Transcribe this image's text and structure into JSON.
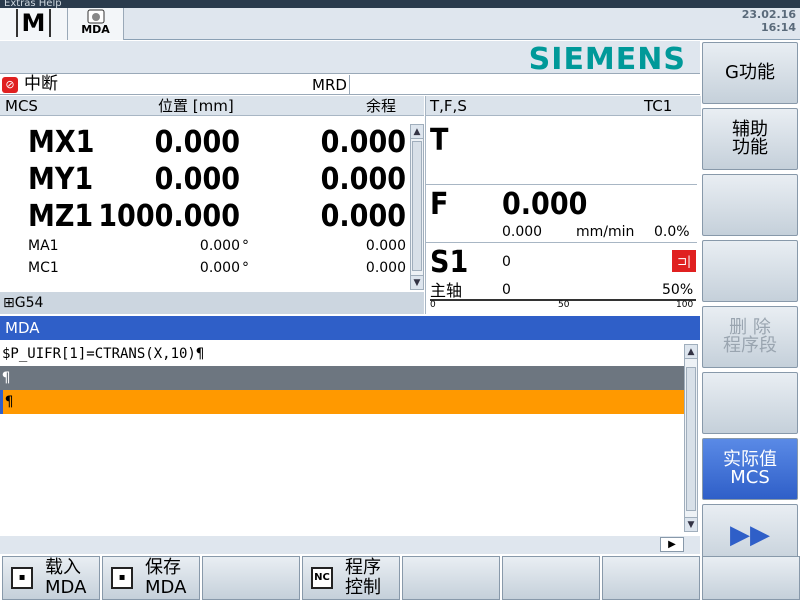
{
  "menubar": {
    "text": "Extras   Help"
  },
  "header": {
    "mode_icon_letter": "M",
    "mda_label": "MDA",
    "date": "23.02.16",
    "time": "16:14"
  },
  "brand": "SIEMENS",
  "status": {
    "alarm": "中断",
    "mrd": "MRD"
  },
  "position_pane": {
    "col_mcs": "MCS",
    "col_position": "位置 [mm]",
    "col_remaining": "余程",
    "axes_main": [
      {
        "name": "MX1",
        "pos": "0.000",
        "rest": "0.000"
      },
      {
        "name": "MY1",
        "pos": "0.000",
        "rest": "0.000"
      },
      {
        "name": "MZ1",
        "pos": "1000.000",
        "rest": "0.000"
      }
    ],
    "axes_small": [
      {
        "name": "MA1",
        "pos": "0.000",
        "unit": "°",
        "rest": "0.000"
      },
      {
        "name": "MC1",
        "pos": "0.000",
        "unit": "°",
        "rest": "0.000"
      }
    ],
    "frame": "G54"
  },
  "tfs": {
    "title": "T,F,S",
    "tool_carrier": "TC1",
    "t_label": "T",
    "f_label": "F",
    "f_value": "0.000",
    "f_actual": "0.000",
    "f_unit": "mm/min",
    "f_override": "0.0%",
    "s_label": "S1",
    "s_value": "0",
    "spindle_label": "主轴",
    "spindle_value": "0",
    "spindle_override": "50%",
    "scale": [
      "0",
      "50",
      "100"
    ],
    "spindle_bar_fraction": 0.0
  },
  "mda": {
    "title": "MDA",
    "lines": [
      "$P_UIFR[1]=CTRANS(X,10)¶",
      "¶",
      "¶"
    ]
  },
  "softkeys": [
    {
      "label": "G功能",
      "state": "normal"
    },
    {
      "label": "辅助\n功能",
      "state": "normal"
    },
    {
      "label": "",
      "state": "normal"
    },
    {
      "label": "",
      "state": "normal"
    },
    {
      "label": "删 除\n程序段",
      "state": "disabled"
    },
    {
      "label": "",
      "state": "normal"
    },
    {
      "label": "实际值\nMCS",
      "state": "active"
    },
    {
      "label": "▶▶",
      "state": "normal"
    }
  ],
  "hkeys": [
    {
      "label": "载入\nMDA",
      "icon": "load-icon"
    },
    {
      "label": "保存\nMDA",
      "icon": "save-icon"
    },
    {
      "label": ""
    },
    {
      "label": "程序\n控制",
      "icon": "nc-icon"
    },
    {
      "label": ""
    },
    {
      "label": ""
    },
    {
      "label": ""
    },
    {
      "label": ""
    }
  ],
  "colors": {
    "accent": "#2f5fc8",
    "brand": "#009999",
    "highlight": "#ff9900",
    "alarm": "#e02020"
  }
}
